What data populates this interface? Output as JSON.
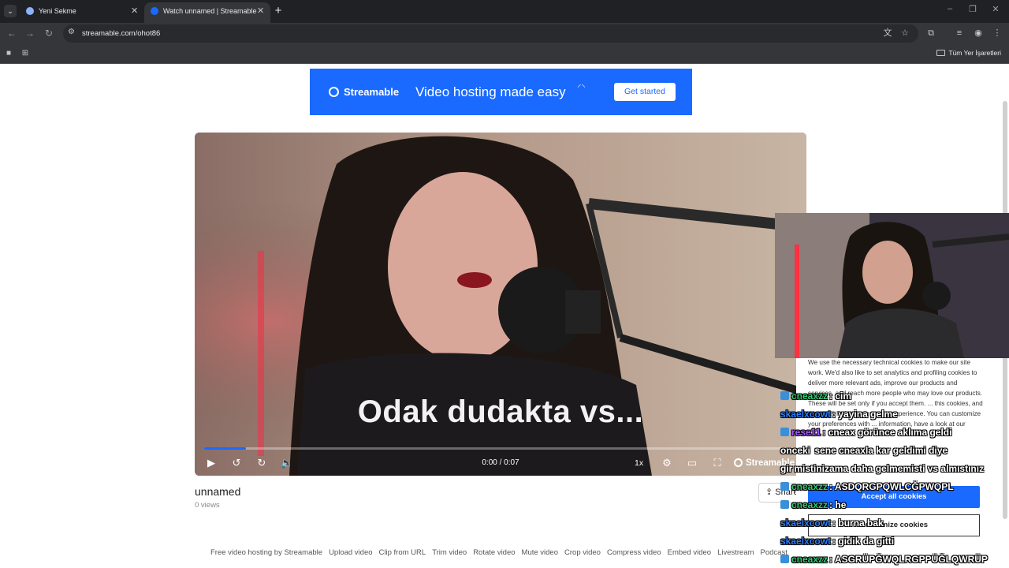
{
  "browser": {
    "tabs": [
      {
        "title": "Yeni Sekme",
        "close": "✕"
      },
      {
        "title": "Watch unnamed | Streamable",
        "close": "✕"
      }
    ],
    "new_tab": "+",
    "url": "streamable.com/ohot86",
    "bookmarks_all": "Tüm Yer İşaretleri"
  },
  "banner": {
    "logo": "Streamable",
    "tagline": "Video hosting made easy",
    "cta": "Get started"
  },
  "player": {
    "caption": "Odak dudakta vs...",
    "time": "0:00 / 0:07",
    "speed": "1x",
    "brand": "Streamable",
    "progress_fraction": 0.07
  },
  "video": {
    "title": "unnamed",
    "views": "0 views",
    "share": "Share"
  },
  "cookie": {
    "text": "We use the necessary technical cookies to make our site work. We'd also like to set analytics and profiling cookies to deliver more relevant ads, improve our products and services, and reach more people who may love our products. These will be set only if you accept them. ... this cookies, and this won't limit your browsing experience. You can customize your preferences with ... information, have a look at our",
    "accept": "Accept all cookies",
    "customize": "Customize cookies"
  },
  "footer": {
    "links": [
      "Free video hosting by Streamable",
      "Upload video",
      "Clip from URL",
      "Trim video",
      "Rotate video",
      "Mute video",
      "Crop video",
      "Compress video",
      "Embed video",
      "Livestream",
      "Podcast"
    ]
  },
  "chat": [
    {
      "user": "cneaxzz",
      "msg": ": cim",
      "color": "#2ecc71",
      "badge": true
    },
    {
      "user": "skaelxcowt",
      "msg": ": yayina gelme",
      "color": "#2a7fff",
      "badge": false
    },
    {
      "user": "rese11",
      "msg": ": cneax görünce aklıma geldi",
      "color": "#a35bff",
      "badge": true
    },
    {
      "user": "onceki",
      "msg": " sene cneaxla kar geldimi diye",
      "color": "#ffffff",
      "badge": false
    },
    {
      "user": "gir",
      "msg": "mistinizama daha gelmemisti vs almıstınız",
      "color": "#ffffff",
      "badge": false
    },
    {
      "user": "cneaxzz",
      "msg": ": ASDQRGPQWLCĞPWQPL",
      "color": "#2ecc71",
      "badge": true
    },
    {
      "user": "cneaxzz",
      "msg": ": he",
      "color": "#2ecc71",
      "badge": true
    },
    {
      "user": "skaelxcowt",
      "msg": ": burna bak",
      "color": "#2a7fff",
      "badge": false
    },
    {
      "user": "skaelxcowt",
      "msg": ": gidik da gitti",
      "color": "#2a7fff",
      "badge": false
    },
    {
      "user": "cneaxzz",
      "msg": ": ASGRÜPĞWQLRGPPÜĞLQWRÜP",
      "color": "#2ecc71",
      "badge": true
    }
  ]
}
